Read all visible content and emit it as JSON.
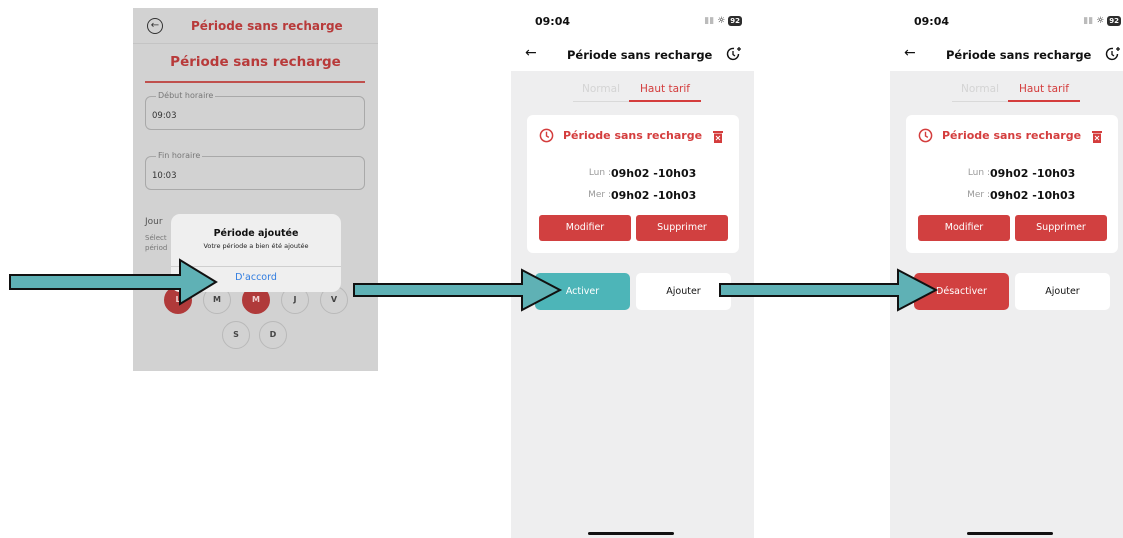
{
  "screen1": {
    "header_title": "Période sans recharge",
    "heading": "Période sans recharge",
    "start_field": {
      "label": "Début horaire",
      "value": "09:03"
    },
    "end_field": {
      "label": "Fin horaire",
      "value": "10:03"
    },
    "days_label": "Jour",
    "days_hint_1": "Sélect",
    "days_hint_2": "périod",
    "days": [
      {
        "label": "L",
        "selected": true
      },
      {
        "label": "M",
        "selected": false
      },
      {
        "label": "M",
        "selected": true
      },
      {
        "label": "J",
        "selected": false
      },
      {
        "label": "V",
        "selected": false
      },
      {
        "label": "S",
        "selected": false
      },
      {
        "label": "D",
        "selected": false
      }
    ],
    "dialog": {
      "title": "Période ajoutée",
      "message": "Votre période a bien été ajoutée",
      "button": "D'accord"
    }
  },
  "screen2": {
    "status_time": "09:04",
    "battery": "92",
    "title": "Période sans recharge",
    "tab_normal": "Normal",
    "tab_active": "Haut tarif",
    "card_title": "Période sans recharge",
    "schedule": [
      {
        "day": "Lun :",
        "hours": "09h02 -10h03"
      },
      {
        "day": "Mer :",
        "hours": "09h02 -10h03"
      }
    ],
    "modify_label": "Modifier",
    "delete_label": "Supprimer",
    "main_action_label": "Activer",
    "add_label": "Ajouter"
  },
  "screen3": {
    "status_time": "09:04",
    "battery": "92",
    "title": "Période sans recharge",
    "tab_normal": "Normal",
    "tab_active": "Haut tarif",
    "card_title": "Période sans recharge",
    "schedule": [
      {
        "day": "Lun :",
        "hours": "09h02 -10h03"
      },
      {
        "day": "Mer :",
        "hours": "09h02 -10h03"
      }
    ],
    "modify_label": "Modifier",
    "delete_label": "Supprimer",
    "main_action_label": "Désactiver",
    "add_label": "Ajouter"
  },
  "colors": {
    "accent_red": "#d14040",
    "activate_teal": "#4db5b8",
    "arrow_fill": "#5fb1b5",
    "dialog_link_blue": "#2f7ce0"
  }
}
